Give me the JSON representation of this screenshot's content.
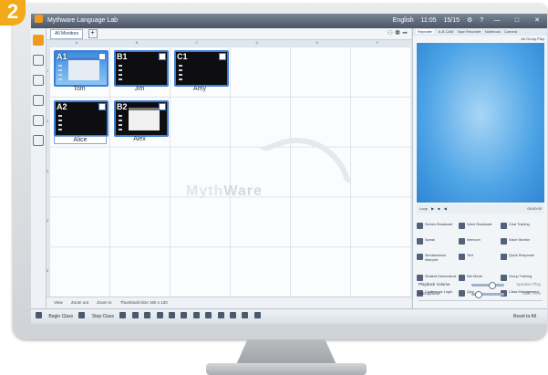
{
  "step_badge": "2",
  "window": {
    "title": "Mythware Language Lab",
    "lang": "English",
    "time": "11:05",
    "users": "15/15",
    "tools": [
      "settings",
      "help"
    ]
  },
  "monitor_tab": {
    "label": "All Monitors",
    "columns": [
      "A",
      "B",
      "C",
      "D",
      "E",
      "F",
      "G"
    ],
    "rows": [
      "1",
      "2",
      "3",
      "4",
      "5"
    ]
  },
  "students": [
    {
      "slot": "A1",
      "name": "Tom",
      "screen": "desktop"
    },
    {
      "slot": "B1",
      "name": "Jim",
      "screen": "dark"
    },
    {
      "slot": "C1",
      "name": "Amy",
      "screen": "dark"
    },
    {
      "slot": "A2",
      "name": "Alice",
      "screen": "dark"
    },
    {
      "slot": "B2",
      "name": "Alex",
      "screen": "dark"
    }
  ],
  "watermark": {
    "prefix": "Myth",
    "suffix": "Ware"
  },
  "statusbar": {
    "view": "View",
    "zoom_out": "Zoom out",
    "zoom_in": "Zoom in",
    "thumb_size": "Thumbnail Size 160 x 120"
  },
  "bottombar": {
    "begin_class": "Begin Class",
    "stop_class": "Stop Class",
    "raise_all": "Reset to All"
  },
  "right_panel": {
    "tabs": [
      "Repeater",
      "A-B CAM",
      "Tape Recorder",
      "Notebook",
      "Camera"
    ],
    "group": "All Group Play",
    "vctrl": [
      "Loop",
      "00:00:00"
    ],
    "features": [
      [
        "Screen Broadcast",
        "Voice Broadcast",
        "Chat Training"
      ],
      [
        "Speak",
        "Intercom",
        "Voice Monitor"
      ],
      [
        "Simultaneous Interpret",
        "Text",
        "Quick Response"
      ],
      [
        "Student Demonstrat.",
        "Net Movie",
        "Group Training"
      ],
      [
        "Conference Login",
        "Quiz",
        "Class Management"
      ]
    ],
    "extras": [
      "Student Collection",
      "Vocab",
      "Competition",
      "Chat",
      "Assistant Tools"
    ],
    "playback_volume": "Playback Volume",
    "speaker_play": "Speaker Play",
    "microphone": "Microphone",
    "side_time": "Side Time"
  }
}
